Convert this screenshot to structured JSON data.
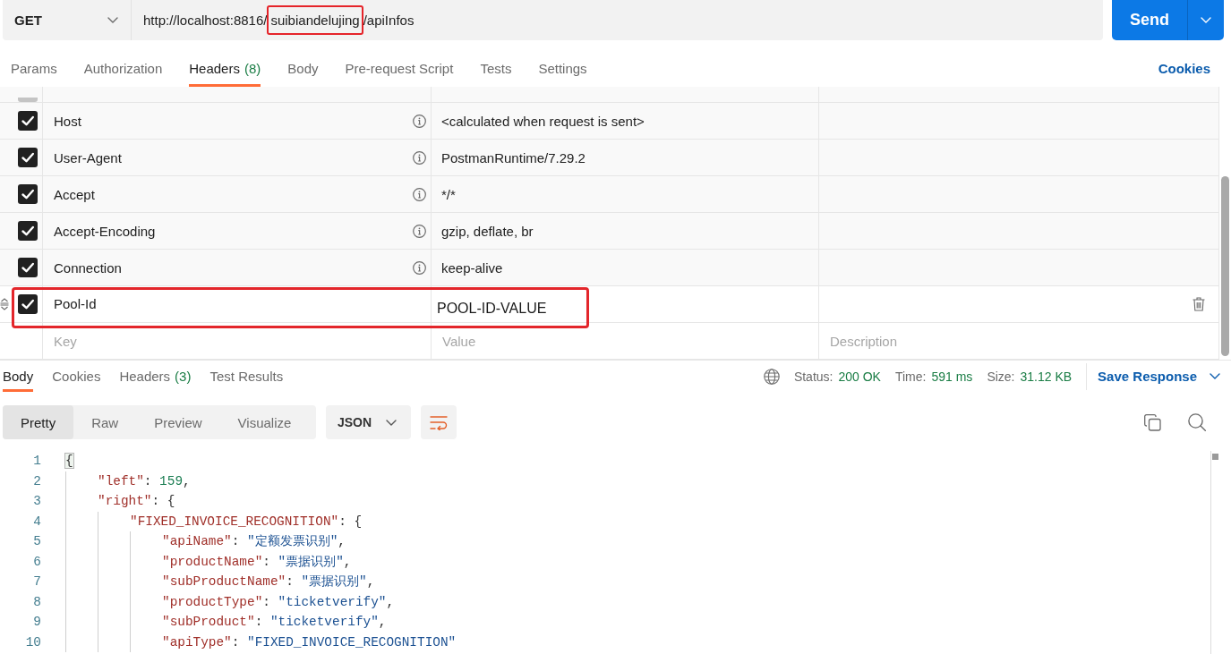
{
  "request_bar": {
    "method": "GET",
    "url_parts": [
      {
        "text": "http://localhost:8816/",
        "annotated": false
      },
      {
        "text": "suibiandelujing",
        "annotated": true
      },
      {
        "text": "/apiInfos",
        "annotated": false
      }
    ],
    "send": "Send"
  },
  "request_tabs": [
    {
      "label": "Params",
      "selected": false
    },
    {
      "label": "Authorization",
      "selected": false
    },
    {
      "label": "Headers",
      "count": "(8)",
      "selected": true
    },
    {
      "label": "Body",
      "selected": false
    },
    {
      "label": "Pre-request Script",
      "selected": false
    },
    {
      "label": "Tests",
      "selected": false
    },
    {
      "label": "Settings",
      "selected": false
    }
  ],
  "cookies_link": "Cookies",
  "headers_table": {
    "rows": [
      {
        "kind": "cut_off"
      },
      {
        "kind": "auto",
        "checked": true,
        "key": "Host",
        "value": "<calculated when request is sent>"
      },
      {
        "kind": "auto",
        "checked": true,
        "key": "User-Agent",
        "value": "PostmanRuntime/7.29.2"
      },
      {
        "kind": "auto",
        "checked": true,
        "key": "Accept",
        "value": "*/*"
      },
      {
        "kind": "auto",
        "checked": true,
        "key": "Accept-Encoding",
        "value": "gzip, deflate, br"
      },
      {
        "kind": "auto",
        "checked": true,
        "key": "Connection",
        "value": "keep-alive"
      },
      {
        "kind": "custom",
        "checked": true,
        "key": "Pool-Id",
        "value": "POOL-ID-VALUE",
        "annotated": true
      }
    ],
    "new_row": {
      "key": {
        "placeholder": "Key"
      },
      "value": {
        "placeholder": "Value"
      },
      "description": {
        "placeholder": "Description"
      }
    }
  },
  "response": {
    "tabs": [
      {
        "label": "Body",
        "selected": true
      },
      {
        "label": "Cookies",
        "selected": false
      },
      {
        "label": "Headers",
        "count": "(3)",
        "selected": false
      },
      {
        "label": "Test Results",
        "selected": false
      }
    ],
    "meta": [
      {
        "label": "Status:",
        "value": "200 OK"
      },
      {
        "label": "Time:",
        "value": "591 ms"
      },
      {
        "label": "Size:",
        "value": "31.12 KB"
      }
    ],
    "save": "Save Response",
    "views": [
      {
        "label": "Pretty",
        "selected": true
      },
      {
        "label": "Raw",
        "selected": false
      },
      {
        "label": "Preview",
        "selected": false
      },
      {
        "label": "Visualize",
        "selected": false
      }
    ],
    "format": "JSON",
    "lines": [
      {
        "number": "1",
        "tokens": [
          {
            "kind": "brace",
            "text": "{",
            "matched": true
          }
        ],
        "children": [
          {
            "number": "2",
            "tokens": [
              {
                "kind": "key",
                "text": "\"left\""
              },
              {
                "kind": "punct",
                "text": ": "
              },
              {
                "kind": "number",
                "text": "159"
              },
              {
                "kind": "punct",
                "text": ","
              }
            ]
          },
          {
            "number": "3",
            "tokens": [
              {
                "kind": "key",
                "text": "\"right\""
              },
              {
                "kind": "punct",
                "text": ": "
              },
              {
                "kind": "brace",
                "text": "{",
                "matched": false
              }
            ],
            "children": [
              {
                "number": "4",
                "tokens": [
                  {
                    "kind": "key",
                    "text": "\"FIXED_INVOICE_RECOGNITION\""
                  },
                  {
                    "kind": "punct",
                    "text": ": "
                  },
                  {
                    "kind": "brace",
                    "text": "{",
                    "matched": false
                  }
                ],
                "children": [
                  {
                    "number": "5",
                    "tokens": [
                      {
                        "kind": "key",
                        "text": "\"apiName\""
                      },
                      {
                        "kind": "punct",
                        "text": ": "
                      },
                      {
                        "kind": "string",
                        "text": "\"定额发票识别\""
                      },
                      {
                        "kind": "punct",
                        "text": ","
                      }
                    ]
                  },
                  {
                    "number": "6",
                    "tokens": [
                      {
                        "kind": "key",
                        "text": "\"productName\""
                      },
                      {
                        "kind": "punct",
                        "text": ": "
                      },
                      {
                        "kind": "string",
                        "text": "\"票据识别\""
                      },
                      {
                        "kind": "punct",
                        "text": ","
                      }
                    ]
                  },
                  {
                    "number": "7",
                    "tokens": [
                      {
                        "kind": "key",
                        "text": "\"subProductName\""
                      },
                      {
                        "kind": "punct",
                        "text": ": "
                      },
                      {
                        "kind": "string",
                        "text": "\"票据识别\""
                      },
                      {
                        "kind": "punct",
                        "text": ","
                      }
                    ]
                  },
                  {
                    "number": "8",
                    "tokens": [
                      {
                        "kind": "key",
                        "text": "\"productType\""
                      },
                      {
                        "kind": "punct",
                        "text": ": "
                      },
                      {
                        "kind": "string",
                        "text": "\"ticketverify\""
                      },
                      {
                        "kind": "punct",
                        "text": ","
                      }
                    ]
                  },
                  {
                    "number": "9",
                    "tokens": [
                      {
                        "kind": "key",
                        "text": "\"subProduct\""
                      },
                      {
                        "kind": "punct",
                        "text": ": "
                      },
                      {
                        "kind": "string",
                        "text": "\"ticketverify\""
                      },
                      {
                        "kind": "punct",
                        "text": ","
                      }
                    ]
                  },
                  {
                    "number": "10",
                    "tokens": [
                      {
                        "kind": "key",
                        "text": "\"apiType\""
                      },
                      {
                        "kind": "punct",
                        "text": ": "
                      },
                      {
                        "kind": "string",
                        "text": "\"FIXED_INVOICE_RECOGNITION\""
                      }
                    ]
                  }
                ]
              }
            ]
          }
        ]
      }
    ]
  }
}
